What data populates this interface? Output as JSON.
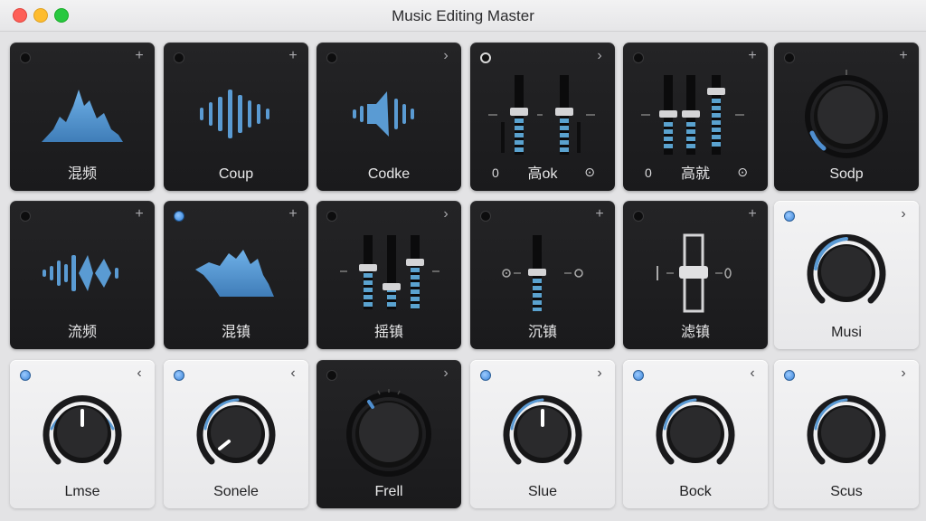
{
  "window": {
    "title": "Music Editing Master"
  },
  "tiles": [
    {
      "label": "混频",
      "corner": "+"
    },
    {
      "label": "Coup",
      "corner": "+"
    },
    {
      "label": "Codke",
      "corner": "›"
    },
    {
      "label": "高ok",
      "corner": "›",
      "left": "0",
      "right": "⊙"
    },
    {
      "label": "高就",
      "corner": "+",
      "left": "0",
      "right": "⊙"
    },
    {
      "label": "Sodp",
      "corner": "+"
    },
    {
      "label": "流频",
      "corner": "+"
    },
    {
      "label": "混镇",
      "corner": "+"
    },
    {
      "label": "摇镇",
      "corner": "›"
    },
    {
      "label": "沉镇",
      "corner": "+"
    },
    {
      "label": "滤镇",
      "corner": "+"
    },
    {
      "label": "Musi",
      "corner": "›"
    },
    {
      "label": "Lmse",
      "corner": "‹"
    },
    {
      "label": "Sonele",
      "corner": "‹"
    },
    {
      "label": "Frell",
      "corner": "›"
    },
    {
      "label": "Slue",
      "corner": "›"
    },
    {
      "label": "Bock",
      "corner": "‹"
    },
    {
      "label": "Scus",
      "corner": "›"
    }
  ],
  "colors": {
    "accent": "#5b9bd5",
    "dark_tile": "#1e1e20",
    "light_tile": "#efeff1"
  }
}
